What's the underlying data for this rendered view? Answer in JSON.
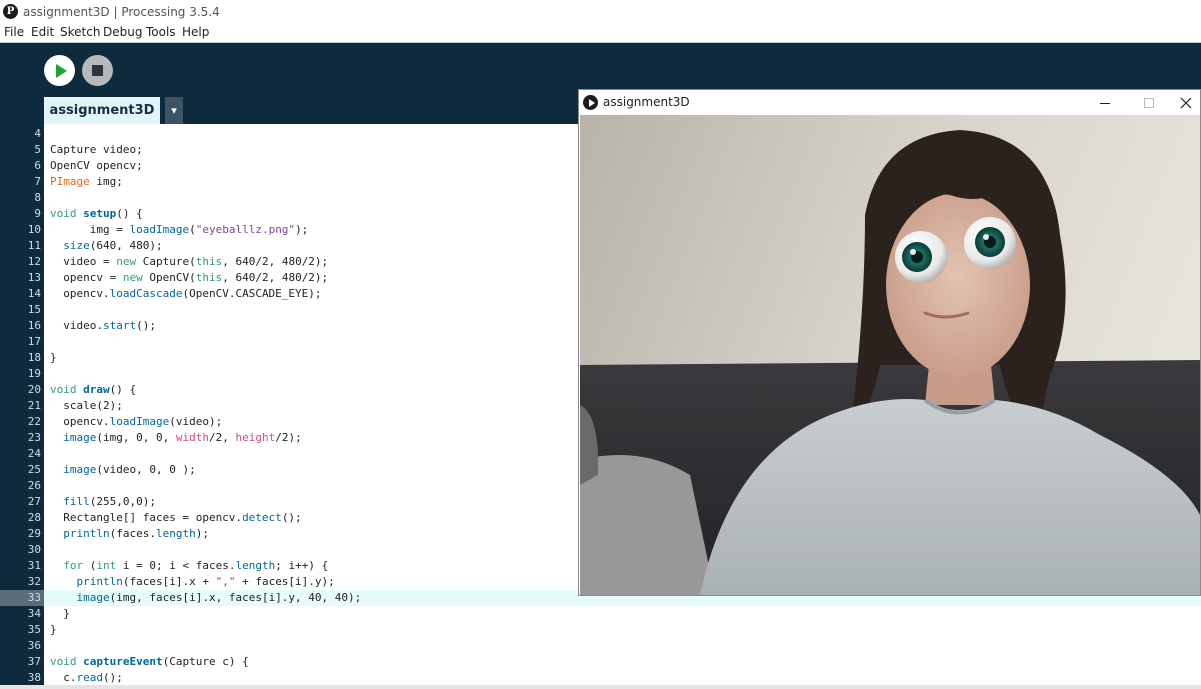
{
  "window": {
    "title": "assignment3D | Processing 3.5.4",
    "app_icon": "P"
  },
  "menu": [
    "File",
    "Edit",
    "Sketch",
    "Debug",
    "Tools",
    "Help"
  ],
  "toolbar": {
    "run_icon": "play-icon",
    "stop_icon": "stop-icon"
  },
  "tabs": [
    {
      "label": "assignment3D",
      "active": true
    }
  ],
  "tab_dropdown_glyph": "▾",
  "editor": {
    "highlighted_line": 33,
    "lines": [
      {
        "n": "4",
        "text": ""
      },
      {
        "n": "5",
        "text": "Capture video;"
      },
      {
        "n": "6",
        "text": "OpenCV opencv;"
      },
      {
        "n": "7",
        "text": "PImage img;"
      },
      {
        "n": "8",
        "text": ""
      },
      {
        "n": "9",
        "text": "void setup() {"
      },
      {
        "n": "10",
        "text": "      img = loadImage(\"eyeballlz.png\");"
      },
      {
        "n": "11",
        "text": "  size(640, 480);"
      },
      {
        "n": "12",
        "text": "  video = new Capture(this, 640/2, 480/2);"
      },
      {
        "n": "13",
        "text": "  opencv = new OpenCV(this, 640/2, 480/2);"
      },
      {
        "n": "14",
        "text": "  opencv.loadCascade(OpenCV.CASCADE_EYE);"
      },
      {
        "n": "15",
        "text": ""
      },
      {
        "n": "16",
        "text": "  video.start();"
      },
      {
        "n": "17",
        "text": ""
      },
      {
        "n": "18",
        "text": "}"
      },
      {
        "n": "19",
        "text": ""
      },
      {
        "n": "20",
        "text": "void draw() {"
      },
      {
        "n": "21",
        "text": "  scale(2);"
      },
      {
        "n": "22",
        "text": "  opencv.loadImage(video);"
      },
      {
        "n": "23",
        "text": "  image(img, 0, 0, width/2, height/2);"
      },
      {
        "n": "24",
        "text": ""
      },
      {
        "n": "25",
        "text": "  image(video, 0, 0 );"
      },
      {
        "n": "26",
        "text": ""
      },
      {
        "n": "27",
        "text": "  fill(255,0,0);"
      },
      {
        "n": "28",
        "text": "  Rectangle[] faces = opencv.detect();"
      },
      {
        "n": "29",
        "text": "  println(faces.length);"
      },
      {
        "n": "30",
        "text": ""
      },
      {
        "n": "31",
        "text": "  for (int i = 0; i < faces.length; i++) {"
      },
      {
        "n": "32",
        "text": "    println(faces[i].x + \",\" + faces[i].y);"
      },
      {
        "n": "33",
        "text": "    image(img, faces[i].x, faces[i].y, 40, 40);"
      },
      {
        "n": "34",
        "text": "  }"
      },
      {
        "n": "35",
        "text": "}"
      },
      {
        "n": "36",
        "text": ""
      },
      {
        "n": "37",
        "text": "void captureEvent(Capture c) {"
      },
      {
        "n": "38",
        "text": "  c.read();"
      }
    ]
  },
  "sketch_window": {
    "title": "assignment3D",
    "icon": "processing-run-icon",
    "controls": [
      "minimize-icon",
      "maximize-icon",
      "close-icon"
    ]
  },
  "colors": {
    "toolbar_bg": "#0e2a3d",
    "tab_bg": "#e2f6fa",
    "keyword_green": "#33997e",
    "type_orange": "#e2661a",
    "function_blue": "#006699",
    "string_purple": "#7d4793",
    "builtin_pink": "#d94a7a",
    "run_green": "#1ea33a"
  }
}
